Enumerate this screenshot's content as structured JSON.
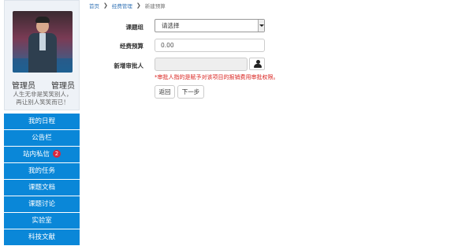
{
  "sidebar": {
    "profile": {
      "name_left": "管理员",
      "name_right": "管理员",
      "motto_line1": "人生无非是笑笑别人，",
      "motto_line2": "再让别人笑笑而已！"
    },
    "menu": [
      {
        "label": "我的日程"
      },
      {
        "label": "公告栏"
      },
      {
        "label": "站内私信",
        "badge": "2"
      },
      {
        "label": "我的任务"
      },
      {
        "label": "课题文档"
      },
      {
        "label": "课题讨论"
      },
      {
        "label": "实验室"
      },
      {
        "label": "科技文献"
      }
    ]
  },
  "breadcrumb": {
    "home": "首页",
    "section": "经费管理",
    "current": "新建预算"
  },
  "form": {
    "group_label": "课题组",
    "group_value": "请选择",
    "budget_label": "经费预算",
    "budget_value": "0.00",
    "approver_label": "新增审批人",
    "approver_value": "",
    "warning": "*审批人指的是赋予对该项目的报销费用审批权限。",
    "back_button": "返回",
    "next_button": "下一步"
  },
  "icons": {
    "approver_picker": "user-icon"
  },
  "colors": {
    "menu_bg": "#0a87d8",
    "warning": "#d9231f",
    "badge": "#d9263c"
  }
}
